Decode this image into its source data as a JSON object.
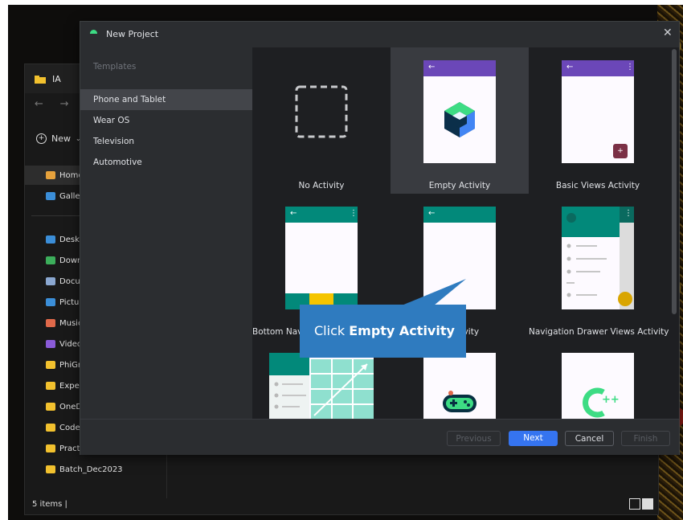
{
  "explorer": {
    "title": "IA",
    "nav_back": "←",
    "nav_forward": "→",
    "new_label": "New",
    "sidebar": [
      {
        "label": "Home",
        "color": "#e6a23c"
      },
      {
        "label": "Galler",
        "color": "#3b8ed8"
      },
      {
        "label": "Deskt",
        "color": "#3b8ed8"
      },
      {
        "label": "Down",
        "color": "#3cae5b"
      },
      {
        "label": "Docu",
        "color": "#8aa7d0"
      },
      {
        "label": "Pictur",
        "color": "#3b8ed8"
      },
      {
        "label": "Music",
        "color": "#e0694a"
      },
      {
        "label": "Video",
        "color": "#8a5bd8"
      },
      {
        "label": "PhiGr",
        "color": "#f2c12e"
      },
      {
        "label": "Exper",
        "color": "#f2c12e"
      },
      {
        "label": "OneD",
        "color": "#f2c12e"
      },
      {
        "label": "Code",
        "color": "#f2c12e"
      },
      {
        "label": "Practi",
        "color": "#f2c12e"
      },
      {
        "label": "Batch_Dec2023",
        "color": "#f2c12e"
      }
    ],
    "status": "5 items"
  },
  "dialog": {
    "title": "New Project",
    "close": "✕",
    "templates_header": "Templates",
    "categories": [
      "Phone and Tablet",
      "Wear OS",
      "Television",
      "Automotive"
    ],
    "tiles": [
      {
        "label": "No Activity"
      },
      {
        "label": "Empty Activity"
      },
      {
        "label": "Basic Views Activity"
      },
      {
        "label": "Bottom Nav"
      },
      {
        "label": "s Activity"
      },
      {
        "label": "Navigation Drawer Views Activity"
      },
      {
        "label": ""
      },
      {
        "label": ""
      },
      {
        "label": ""
      }
    ],
    "buttons": {
      "previous": "Previous",
      "next": "Next",
      "cancel": "Cancel",
      "finish": "Finish"
    },
    "colors": {
      "purple": "#6b47b8",
      "teal": "#02897a",
      "accent": "#3574f0",
      "fab": "#7b3046",
      "yellow": "#f5c400"
    }
  },
  "callout": {
    "prefix": "Click ",
    "bold": "Empty Activity",
    "color": "#2f7bbf"
  }
}
